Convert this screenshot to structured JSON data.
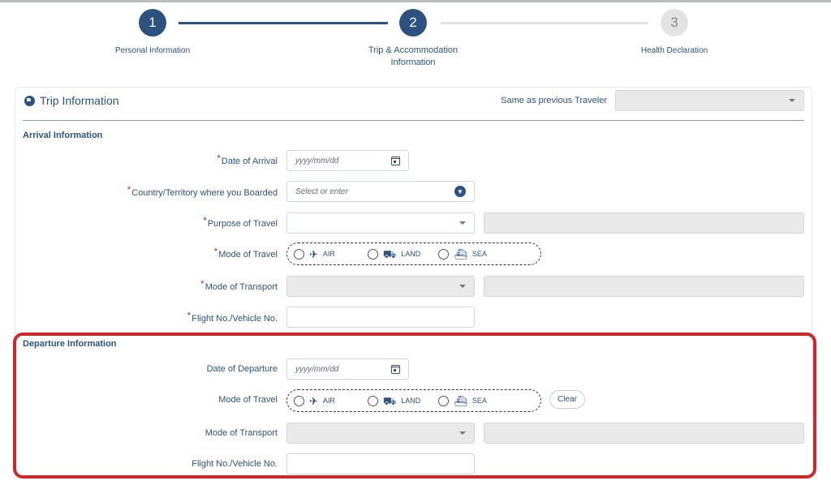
{
  "stepper": {
    "steps": [
      {
        "number": "1",
        "label": "Personal Information"
      },
      {
        "number": "2",
        "label_line1": "Trip & Accommodation",
        "label_line2": "Information"
      },
      {
        "number": "3",
        "label": "Health Declaration"
      }
    ]
  },
  "trip": {
    "title": "Trip Information",
    "same_as_prev_label": "Same as previous Traveler",
    "same_as_prev_value": ""
  },
  "arrival": {
    "title": "Arrival Information",
    "date_label": "Date of Arrival",
    "date_placeholder": "yyyy/mm/dd",
    "country_label": "Country/Territory where you Boarded",
    "country_placeholder": "Select or enter",
    "purpose_label": "Purpose of Travel",
    "purpose_value": "",
    "mode_label": "Mode of Travel",
    "modes": [
      "AIR",
      "LAND",
      "SEA"
    ],
    "transport_label": "Mode of Transport",
    "flight_label": "Flight No./Vehicle No.",
    "flight_value": ""
  },
  "departure": {
    "title": "Departure Information",
    "date_label": "Date of Departure",
    "date_placeholder": "yyyy/mm/dd",
    "mode_label": "Mode of Travel",
    "modes": [
      "AIR",
      "LAND",
      "SEA"
    ],
    "clear_label": "Clear",
    "transport_label": "Mode of Transport",
    "flight_label": "Flight No./Vehicle No.",
    "flight_value": ""
  },
  "colors": {
    "primary": "#2c5282",
    "inactive_step": "#e3e3e3",
    "required": "#d32f2f",
    "highlight": "#d0282a"
  },
  "icons": {
    "section": "globe-icon",
    "date": "calendar-icon",
    "air": "airplane-icon",
    "land": "car-icon",
    "sea": "ship-icon"
  }
}
